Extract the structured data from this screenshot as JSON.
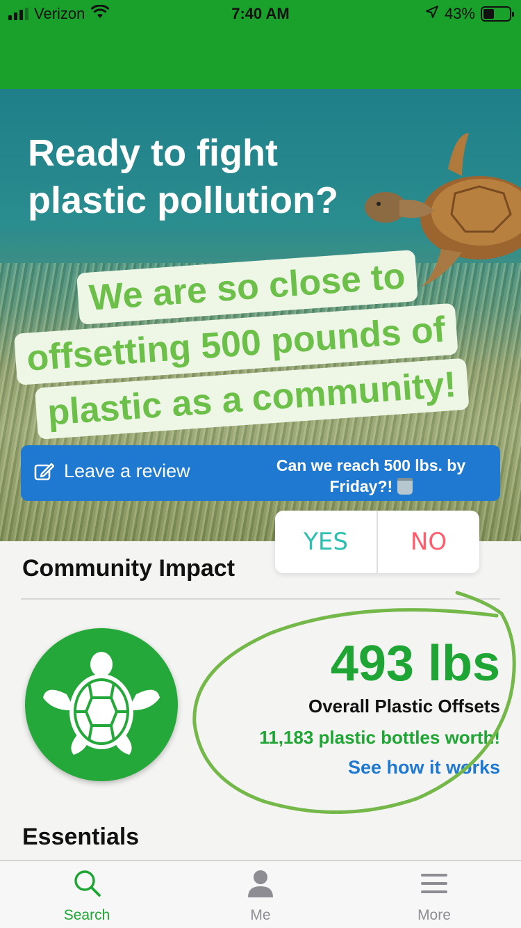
{
  "status_bar": {
    "carrier": "Verizon",
    "time": "7:40 AM",
    "battery": "43%",
    "battery_level": 0.43,
    "icons": [
      "signal-icon",
      "wifi-icon",
      "location-arrow-icon",
      "battery-icon"
    ]
  },
  "hero": {
    "title_line1": "Ready to fight",
    "title_line2": "plastic pollution?",
    "sticker_line1": "We are so close to",
    "sticker_line2": "offsetting 500 pounds of",
    "sticker_line3": "plastic as a community!",
    "review_label": "Leave a review",
    "question": "Can we reach 500 lbs. by Friday?!"
  },
  "poll": {
    "yes": "YES",
    "no": "NO"
  },
  "community": {
    "title": "Community Impact",
    "amount": "493 lbs",
    "amount_label": "Overall Plastic Offsets",
    "bottles": "11,183 plastic bottles worth!",
    "how_link": "See how it works"
  },
  "essentials": {
    "title": "Essentials"
  },
  "tabs": [
    {
      "label": "Search",
      "icon": "search-icon",
      "active": true
    },
    {
      "label": "Me",
      "icon": "person-icon",
      "active": false
    },
    {
      "label": "More",
      "icon": "menu-icon",
      "active": false
    }
  ],
  "colors": {
    "brand_green": "#19a12b",
    "accent_green": "#1ea534",
    "link_blue": "#1f79d0",
    "sticker_green": "#6cc04a",
    "poll_yes": "#2cc0b0",
    "poll_no": "#ff5d6c"
  }
}
